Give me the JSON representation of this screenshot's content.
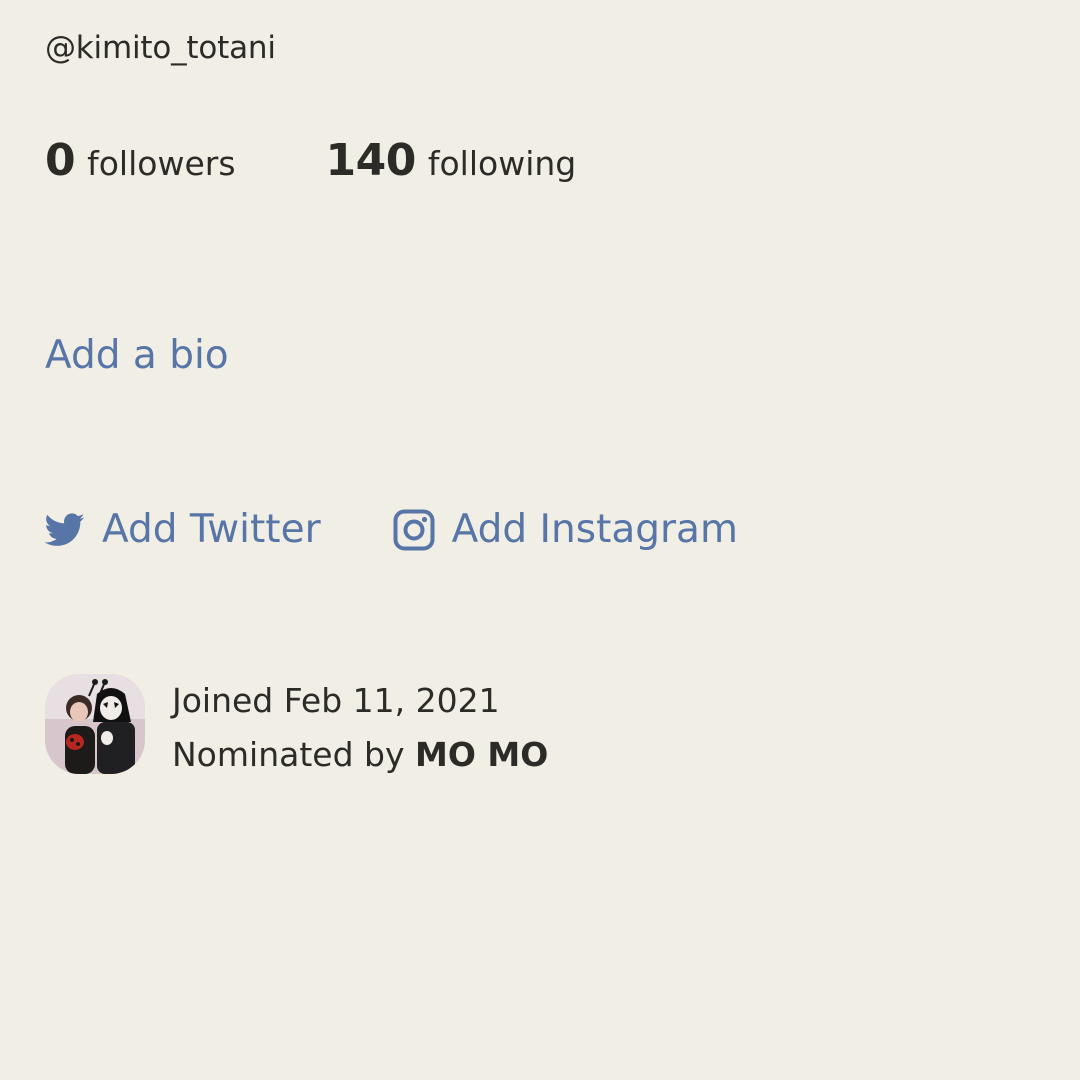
{
  "profile": {
    "username": "@kimito_totani",
    "followers_count": "0",
    "followers_label": "followers",
    "following_count": "140",
    "following_label": "following",
    "bio_placeholder": "Add a bio",
    "twitter_label": "Add Twitter",
    "instagram_label": "Add Instagram",
    "joined_text": "Joined Feb 11, 2021",
    "nominated_prefix": "Nominated by",
    "nominator_name": "MO MO"
  },
  "icons": {
    "twitter": "twitter-bird-icon",
    "instagram": "instagram-camera-icon"
  },
  "colors": {
    "background": "#f1efe5",
    "text": "#2d2b28",
    "link": "#5775a6"
  }
}
